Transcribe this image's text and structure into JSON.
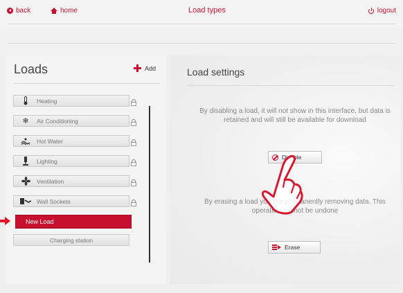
{
  "header": {
    "back_label": "back",
    "home_label": "home",
    "title": "Load types",
    "logout_label": "logout"
  },
  "sidebar": {
    "title": "Loads",
    "add_label": "Add",
    "items": [
      {
        "label": "Heating",
        "icon": "thermometer-icon"
      },
      {
        "label": "Air Conditioning",
        "icon": "snowflake-icon"
      },
      {
        "label": "Hot Water",
        "icon": "water-icon"
      },
      {
        "label": "Lighting",
        "icon": "lamp-icon"
      },
      {
        "label": "Ventilation",
        "icon": "fan-icon"
      },
      {
        "label": "Wall Sockets",
        "icon": "plug-icon"
      },
      {
        "label": "New Load",
        "icon": "",
        "selected": true
      },
      {
        "label": "Charging station",
        "icon": ""
      }
    ]
  },
  "main": {
    "title": "Load settings",
    "disable_text": "By disabling a load, it will not show in this interface, but data is retained and will still be available for download",
    "disable_button": "Disable",
    "erase_text": "By erasing a load you are permanently removing data. This operation cannot be undone",
    "erase_button": "Erase"
  },
  "colors": {
    "accent": "#c8102e",
    "selected_item": "#c8102e",
    "pointer_arrow": "#e8112d"
  }
}
